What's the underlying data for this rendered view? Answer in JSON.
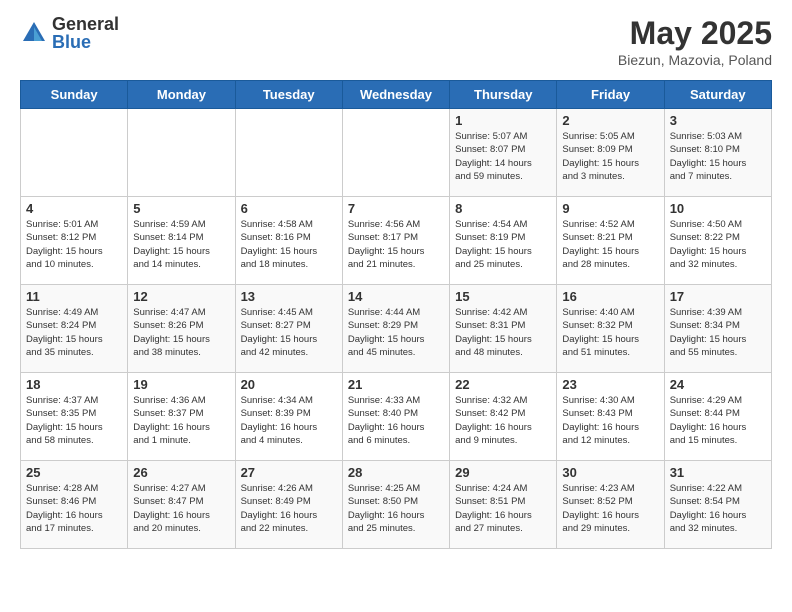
{
  "header": {
    "logo_general": "General",
    "logo_blue": "Blue",
    "month_title": "May 2025",
    "subtitle": "Biezun, Mazovia, Poland"
  },
  "weekdays": [
    "Sunday",
    "Monday",
    "Tuesday",
    "Wednesday",
    "Thursday",
    "Friday",
    "Saturday"
  ],
  "weeks": [
    [
      {
        "day": "",
        "info": ""
      },
      {
        "day": "",
        "info": ""
      },
      {
        "day": "",
        "info": ""
      },
      {
        "day": "",
        "info": ""
      },
      {
        "day": "1",
        "info": "Sunrise: 5:07 AM\nSunset: 8:07 PM\nDaylight: 14 hours\nand 59 minutes."
      },
      {
        "day": "2",
        "info": "Sunrise: 5:05 AM\nSunset: 8:09 PM\nDaylight: 15 hours\nand 3 minutes."
      },
      {
        "day": "3",
        "info": "Sunrise: 5:03 AM\nSunset: 8:10 PM\nDaylight: 15 hours\nand 7 minutes."
      }
    ],
    [
      {
        "day": "4",
        "info": "Sunrise: 5:01 AM\nSunset: 8:12 PM\nDaylight: 15 hours\nand 10 minutes."
      },
      {
        "day": "5",
        "info": "Sunrise: 4:59 AM\nSunset: 8:14 PM\nDaylight: 15 hours\nand 14 minutes."
      },
      {
        "day": "6",
        "info": "Sunrise: 4:58 AM\nSunset: 8:16 PM\nDaylight: 15 hours\nand 18 minutes."
      },
      {
        "day": "7",
        "info": "Sunrise: 4:56 AM\nSunset: 8:17 PM\nDaylight: 15 hours\nand 21 minutes."
      },
      {
        "day": "8",
        "info": "Sunrise: 4:54 AM\nSunset: 8:19 PM\nDaylight: 15 hours\nand 25 minutes."
      },
      {
        "day": "9",
        "info": "Sunrise: 4:52 AM\nSunset: 8:21 PM\nDaylight: 15 hours\nand 28 minutes."
      },
      {
        "day": "10",
        "info": "Sunrise: 4:50 AM\nSunset: 8:22 PM\nDaylight: 15 hours\nand 32 minutes."
      }
    ],
    [
      {
        "day": "11",
        "info": "Sunrise: 4:49 AM\nSunset: 8:24 PM\nDaylight: 15 hours\nand 35 minutes."
      },
      {
        "day": "12",
        "info": "Sunrise: 4:47 AM\nSunset: 8:26 PM\nDaylight: 15 hours\nand 38 minutes."
      },
      {
        "day": "13",
        "info": "Sunrise: 4:45 AM\nSunset: 8:27 PM\nDaylight: 15 hours\nand 42 minutes."
      },
      {
        "day": "14",
        "info": "Sunrise: 4:44 AM\nSunset: 8:29 PM\nDaylight: 15 hours\nand 45 minutes."
      },
      {
        "day": "15",
        "info": "Sunrise: 4:42 AM\nSunset: 8:31 PM\nDaylight: 15 hours\nand 48 minutes."
      },
      {
        "day": "16",
        "info": "Sunrise: 4:40 AM\nSunset: 8:32 PM\nDaylight: 15 hours\nand 51 minutes."
      },
      {
        "day": "17",
        "info": "Sunrise: 4:39 AM\nSunset: 8:34 PM\nDaylight: 15 hours\nand 55 minutes."
      }
    ],
    [
      {
        "day": "18",
        "info": "Sunrise: 4:37 AM\nSunset: 8:35 PM\nDaylight: 15 hours\nand 58 minutes."
      },
      {
        "day": "19",
        "info": "Sunrise: 4:36 AM\nSunset: 8:37 PM\nDaylight: 16 hours\nand 1 minute."
      },
      {
        "day": "20",
        "info": "Sunrise: 4:34 AM\nSunset: 8:39 PM\nDaylight: 16 hours\nand 4 minutes."
      },
      {
        "day": "21",
        "info": "Sunrise: 4:33 AM\nSunset: 8:40 PM\nDaylight: 16 hours\nand 6 minutes."
      },
      {
        "day": "22",
        "info": "Sunrise: 4:32 AM\nSunset: 8:42 PM\nDaylight: 16 hours\nand 9 minutes."
      },
      {
        "day": "23",
        "info": "Sunrise: 4:30 AM\nSunset: 8:43 PM\nDaylight: 16 hours\nand 12 minutes."
      },
      {
        "day": "24",
        "info": "Sunrise: 4:29 AM\nSunset: 8:44 PM\nDaylight: 16 hours\nand 15 minutes."
      }
    ],
    [
      {
        "day": "25",
        "info": "Sunrise: 4:28 AM\nSunset: 8:46 PM\nDaylight: 16 hours\nand 17 minutes."
      },
      {
        "day": "26",
        "info": "Sunrise: 4:27 AM\nSunset: 8:47 PM\nDaylight: 16 hours\nand 20 minutes."
      },
      {
        "day": "27",
        "info": "Sunrise: 4:26 AM\nSunset: 8:49 PM\nDaylight: 16 hours\nand 22 minutes."
      },
      {
        "day": "28",
        "info": "Sunrise: 4:25 AM\nSunset: 8:50 PM\nDaylight: 16 hours\nand 25 minutes."
      },
      {
        "day": "29",
        "info": "Sunrise: 4:24 AM\nSunset: 8:51 PM\nDaylight: 16 hours\nand 27 minutes."
      },
      {
        "day": "30",
        "info": "Sunrise: 4:23 AM\nSunset: 8:52 PM\nDaylight: 16 hours\nand 29 minutes."
      },
      {
        "day": "31",
        "info": "Sunrise: 4:22 AM\nSunset: 8:54 PM\nDaylight: 16 hours\nand 32 minutes."
      }
    ]
  ]
}
